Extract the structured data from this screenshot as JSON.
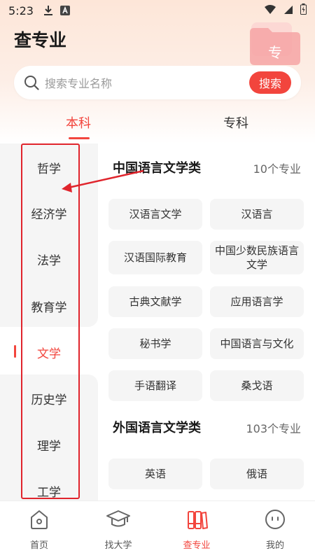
{
  "status_bar": {
    "time": "5:23"
  },
  "header": {
    "title": "查专业",
    "deco_glyph": "专"
  },
  "search": {
    "placeholder": "搜索专业名称",
    "button_label": "搜索"
  },
  "tabs": [
    {
      "label": "本科",
      "active": true
    },
    {
      "label": "专科",
      "active": false
    }
  ],
  "sidebar": {
    "items": [
      "哲学",
      "经济学",
      "法学",
      "教育学",
      "文学",
      "历史学",
      "理学",
      "工学"
    ],
    "active_index": 4
  },
  "categories": [
    {
      "title": "中国语言文学类",
      "count": "10个专业",
      "majors": [
        "汉语言文学",
        "汉语言",
        "汉语国际教育",
        "中国少数民族语言文学",
        "古典文献学",
        "应用语言学",
        "秘书学",
        "中国语言与文化",
        "手语翻译",
        "桑戈语"
      ]
    },
    {
      "title": "外国语言文学类",
      "count": "103个专业",
      "majors": [
        "英语",
        "俄语"
      ]
    }
  ],
  "bottom_nav": [
    {
      "label": "首页",
      "icon": "home-icon",
      "active": false
    },
    {
      "label": "找大学",
      "icon": "graduation-cap-icon",
      "active": false
    },
    {
      "label": "查专业",
      "icon": "books-icon",
      "active": true
    },
    {
      "label": "我的",
      "icon": "profile-face-icon",
      "active": false
    }
  ],
  "colors": {
    "accent": "#f2453d",
    "annotation": "#e0242c"
  }
}
